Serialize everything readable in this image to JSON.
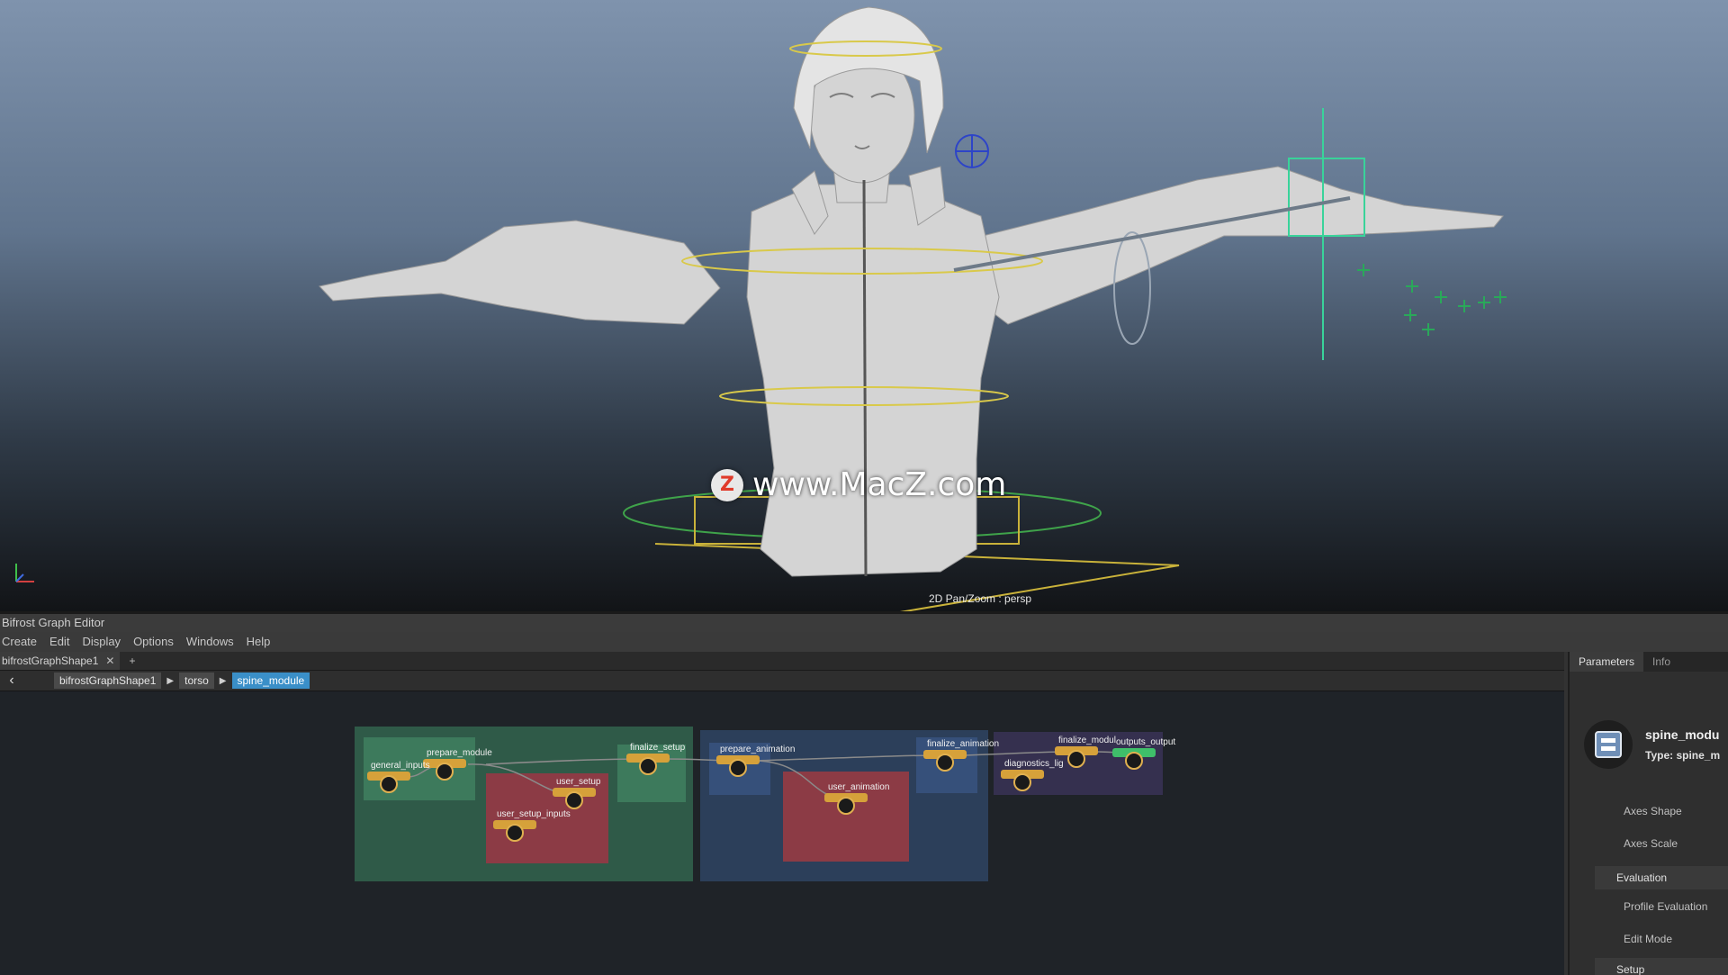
{
  "viewport": {
    "watermark_logo": "Z",
    "watermark_text": "www.MacZ.com",
    "camera_label": "2D Pan/Zoom : persp"
  },
  "editor": {
    "title": "Bifrost Graph Editor",
    "menu": [
      "Create",
      "Edit",
      "Display",
      "Options",
      "Windows",
      "Help"
    ],
    "tab": {
      "label": "bifrostGraphShape1",
      "close_icon": "close-icon",
      "add_label": "+"
    },
    "breadcrumb": [
      "bifrostGraphShape1",
      "torso",
      "spine_module"
    ],
    "nodes": [
      {
        "id": "n1",
        "label": "prepare_module"
      },
      {
        "id": "n2",
        "label": "general_inputs"
      },
      {
        "id": "n3",
        "label": "user_setup"
      },
      {
        "id": "n4",
        "label": "user_setup_inputs"
      },
      {
        "id": "n5",
        "label": "finalize_setup"
      },
      {
        "id": "n6",
        "label": "prepare_animation"
      },
      {
        "id": "n7",
        "label": "user_animation"
      },
      {
        "id": "n8",
        "label": "finalize_animation"
      },
      {
        "id": "n9",
        "label": "diagnostics_lig"
      },
      {
        "id": "n10",
        "label": "finalize_modul"
      },
      {
        "id": "n11",
        "label": "outputs_output"
      }
    ]
  },
  "right_panel": {
    "tabs": [
      "Parameters",
      "Info"
    ],
    "node_name": "spine_modu",
    "node_type": "Type: spine_m",
    "rows": [
      {
        "label": "Axes Shape",
        "kind": "item"
      },
      {
        "label": "Axes Scale",
        "kind": "item"
      },
      {
        "label": "Evaluation",
        "kind": "section"
      },
      {
        "label": "Profile Evaluation",
        "kind": "item"
      },
      {
        "label": "Edit Mode",
        "kind": "item"
      },
      {
        "label": "Setup",
        "kind": "item"
      }
    ]
  },
  "colors": {
    "node_yellow": "#d6a13a",
    "frame_green": "#2f5a48",
    "frame_red": "#8c3b45",
    "frame_blue": "#2c3f5a",
    "frame_purple": "#35304f",
    "breadcrumb_active": "#3a8fc8"
  }
}
